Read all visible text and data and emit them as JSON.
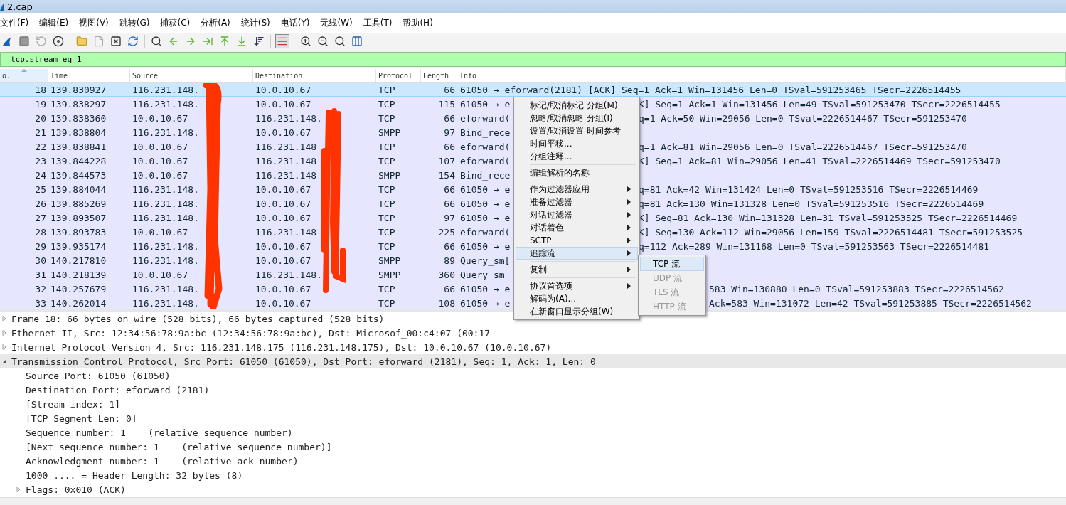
{
  "window": {
    "title": "2.cap"
  },
  "menu_bar": [
    "文件(F)",
    "编辑(E)",
    "视图(V)",
    "跳转(G)",
    "捕获(C)",
    "分析(A)",
    "统计(S)",
    "电话(Y)",
    "无线(W)",
    "工具(T)",
    "帮助(H)"
  ],
  "filter": {
    "value": "tcp.stream eq 1"
  },
  "packet_list": {
    "columns": [
      {
        "label": "o.",
        "sorted": true
      },
      {
        "label": "Time",
        "sorted": false
      },
      {
        "label": "Source",
        "sorted": false
      },
      {
        "label": "Destination",
        "sorted": false
      },
      {
        "label": "Protocol",
        "sorted": false
      },
      {
        "label": "Length",
        "sorted": false
      },
      {
        "label": "Info",
        "sorted": false
      }
    ],
    "rows": [
      {
        "no": "18",
        "time": "139.830927",
        "source": "116.231.148.",
        "destination": "10.0.10.67",
        "protocol": "TCP",
        "length": "66",
        "info": "61050 → eforward(2181) [ACK] Seq=1 Ack=1 Win=131456 Len=0 TSval=591253465 TSecr=2226514455",
        "selected": true
      },
      {
        "no": "19",
        "time": "139.838297",
        "source": "116.231.148.",
        "destination": "10.0.10.67",
        "protocol": "TCP",
        "length": "115",
        "info": "61050 → e",
        "info_tail": "K] Seq=1 Ack=1 Win=131456 Len=49 TSval=591253470 TSecr=2226514455",
        "selected": false
      },
      {
        "no": "20",
        "time": "139.838360",
        "source": "10.0.10.67",
        "destination": "116.231.148.",
        "protocol": "TCP",
        "length": "66",
        "info": "eforward(",
        "info_tail": "q=1 Ack=50 Win=29056 Len=0 TSval=2226514467 TSecr=591253470",
        "selected": false
      },
      {
        "no": "21",
        "time": "139.838804",
        "source": "116.231.148.",
        "destination": "10.0.10.67",
        "protocol": "SMPP",
        "length": "97",
        "info": "Bind_rece",
        "selected": false
      },
      {
        "no": "22",
        "time": "139.838841",
        "source": "10.0.10.67",
        "destination": "116.231.148",
        "protocol": "TCP",
        "length": "66",
        "info": "eforward(",
        "info_tail": "q=1 Ack=81 Win=29056 Len=0 TSval=2226514467 TSecr=591253470",
        "selected": false
      },
      {
        "no": "23",
        "time": "139.844228",
        "source": "10.0.10.67",
        "destination": "116.231.148",
        "protocol": "TCP",
        "length": "107",
        "info": "eforward(",
        "info_tail": "K] Seq=1 Ack=81 Win=29056 Len=41 TSval=2226514469 TSecr=591253470",
        "selected": false
      },
      {
        "no": "24",
        "time": "139.844573",
        "source": "10.0.10.67",
        "destination": "116.231.148",
        "protocol": "SMPP",
        "length": "154",
        "info": "Bind_rece",
        "selected": false
      },
      {
        "no": "25",
        "time": "139.884044",
        "source": "116.231.148.",
        "destination": "10.0.10.67",
        "protocol": "TCP",
        "length": "66",
        "info": "61050 → e",
        "info_tail": "q=81 Ack=42 Win=131424 Len=0 TSval=591253516 TSecr=2226514469",
        "selected": false
      },
      {
        "no": "26",
        "time": "139.885269",
        "source": "116.231.148.",
        "destination": "10.0.10.67",
        "protocol": "TCP",
        "length": "66",
        "info": "61050 → e",
        "info_tail": "q=81 Ack=130 Win=131328 Len=0 TSval=591253516 TSecr=2226514469",
        "selected": false
      },
      {
        "no": "27",
        "time": "139.893507",
        "source": "116.231.148.",
        "destination": "10.0.10.67",
        "protocol": "TCP",
        "length": "97",
        "info": "61050 → e",
        "info_tail": "K] Seq=81 Ack=130 Win=131328 Len=31 TSval=591253525 TSecr=2226514469",
        "selected": false
      },
      {
        "no": "28",
        "time": "139.893783",
        "source": "10.0.10.67",
        "destination": "116.231.148",
        "protocol": "TCP",
        "length": "225",
        "info": "eforward(",
        "info_tail": "K] Seq=130 Ack=112 Win=29056 Len=159 TSval=2226514481 TSecr=591253525",
        "selected": false
      },
      {
        "no": "29",
        "time": "139.935174",
        "source": "116.231.148.",
        "destination": "10.0.10.67",
        "protocol": "TCP",
        "length": "66",
        "info": "61050 → e",
        "info_tail": "q=112 Ack=289 Win=131168 Len=0 TSval=591253563 TSecr=2226514481",
        "selected": false
      },
      {
        "no": "30",
        "time": "140.217810",
        "source": "116.231.148.",
        "destination": "10.0.10.67",
        "protocol": "SMPP",
        "length": "89",
        "info": "Query_sm[",
        "selected": false
      },
      {
        "no": "31",
        "time": "140.218139",
        "source": "10.0.10.67",
        "destination": "116.231.148.",
        "protocol": "SMPP",
        "length": "360",
        "info": "Query_sm",
        "selected": false
      },
      {
        "no": "32",
        "time": "140.257679",
        "source": "116.231.148.",
        "destination": "10.0.10.67",
        "protocol": "TCP",
        "length": "66",
        "info": "61050 → e",
        "info_tail": "583 Win=130880 Len=0 TSval=591253883 TSecr=2226514562",
        "selected": false
      },
      {
        "no": "33",
        "time": "140.262014",
        "source": "116.231.148.",
        "destination": "10.0.10.67",
        "protocol": "TCP",
        "length": "108",
        "info": "61050 → e",
        "info_tail": "Ack=583 Win=131072 Len=42 TSval=591253885 TSecr=2226514562",
        "selected": false
      }
    ]
  },
  "context_menu": {
    "groups": [
      [
        {
          "label": "标记/取消标记 分组(M)",
          "has_submenu": false,
          "highlighted": false
        },
        {
          "label": "忽略/取消忽略 分组(I)",
          "has_submenu": false,
          "highlighted": false
        },
        {
          "label": "设置/取消设置 时间参考",
          "has_submenu": false,
          "highlighted": false
        },
        {
          "label": "时间平移...",
          "has_submenu": false,
          "highlighted": false
        },
        {
          "label": "分组注释...",
          "has_submenu": false,
          "highlighted": false
        }
      ],
      [
        {
          "label": "编辑解析的名称",
          "has_submenu": false,
          "highlighted": false
        }
      ],
      [
        {
          "label": "作为过滤器应用",
          "has_submenu": true,
          "highlighted": false
        },
        {
          "label": "准备过滤器",
          "has_submenu": true,
          "highlighted": false
        },
        {
          "label": "对话过滤器",
          "has_submenu": true,
          "highlighted": false
        },
        {
          "label": "对话着色",
          "has_submenu": true,
          "highlighted": false
        },
        {
          "label": "SCTP",
          "has_submenu": true,
          "highlighted": false
        },
        {
          "label": "追踪流",
          "has_submenu": true,
          "highlighted": true,
          "children": [
            {
              "label": "TCP 流",
              "disabled": false,
              "highlighted": true
            },
            {
              "label": "UDP 流",
              "disabled": true,
              "highlighted": false
            },
            {
              "label": "TLS 流",
              "disabled": true,
              "highlighted": false
            },
            {
              "label": "HTTP 流",
              "disabled": true,
              "highlighted": false
            }
          ]
        }
      ],
      [
        {
          "label": "复制",
          "has_submenu": true,
          "highlighted": false
        }
      ],
      [
        {
          "label": "协议首选项",
          "has_submenu": true,
          "highlighted": false
        },
        {
          "label": "解码为(A)...",
          "has_submenu": false,
          "highlighted": false
        },
        {
          "label": "在新窗口显示分组(W)",
          "has_submenu": false,
          "highlighted": false
        }
      ]
    ]
  },
  "details": {
    "items": [
      {
        "text": "Frame 18: 66 bytes on wire (528 bits), 66 bytes captured (528 bits)",
        "kind": "node",
        "expanded": false,
        "selected": false
      },
      {
        "text": "Ethernet II, Src: 12:34:56:78:9a:bc (12:34:56:78:9a:bc), Dst: Microsof_00:c4:07 (00:17",
        "kind": "node",
        "expanded": false,
        "selected": false
      },
      {
        "text": "Internet Protocol Version 4, Src: 116.231.148.175 (116.231.148.175), Dst: 10.0.10.67 (10.0.10.67)",
        "kind": "node",
        "expanded": false,
        "selected": false
      },
      {
        "text": "Transmission Control Protocol, Src Port: 61050 (61050), Dst Port: eforward (2181), Seq: 1, Ack: 1, Len: 0",
        "kind": "node",
        "expanded": true,
        "selected": true,
        "children": [
          {
            "text": "Source Port: 61050 (61050)",
            "kind": "leaf",
            "selected": false
          },
          {
            "text": "Destination Port: eforward (2181)",
            "kind": "leaf",
            "selected": false
          },
          {
            "text": "[Stream index: 1]",
            "kind": "leaf",
            "selected": false
          },
          {
            "text": "[TCP Segment Len: 0]",
            "kind": "leaf",
            "selected": false
          },
          {
            "text": "Sequence number: 1    (relative sequence number)",
            "kind": "leaf",
            "selected": false
          },
          {
            "text": "[Next sequence number: 1    (relative sequence number)]",
            "kind": "leaf",
            "selected": false
          },
          {
            "text": "Acknowledgment number: 1    (relative ack number)",
            "kind": "leaf",
            "selected": false
          },
          {
            "text": "1000 .... = Header Length: 32 bytes (8)",
            "kind": "leaf",
            "selected": false
          },
          {
            "text": "Flags: 0x010 (ACK)",
            "kind": "node",
            "expanded": false,
            "selected": false
          }
        ]
      }
    ]
  }
}
